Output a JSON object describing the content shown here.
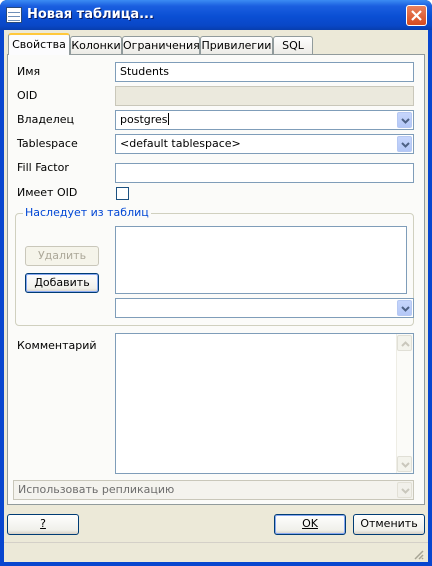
{
  "window": {
    "title": "Новая таблица..."
  },
  "tabs": [
    {
      "label": "Свойства"
    },
    {
      "label": "Колонки"
    },
    {
      "label": "Ограничения"
    },
    {
      "label": "Привилегии"
    },
    {
      "label": "SQL"
    }
  ],
  "form": {
    "name_label": "Имя",
    "name_value": "Students",
    "oid_label": "OID",
    "owner_label": "Владелец",
    "owner_value": "postgres",
    "tablespace_label": "Tablespace",
    "tablespace_value": "<default tablespace>",
    "fillfactor_label": "Fill Factor",
    "fillfactor_value": "",
    "hasoids_label": "Имеет OID",
    "inherits_group": "Наследует из таблиц",
    "remove_button": "Удалить",
    "add_button": "Добавить",
    "comment_label": "Комментарий",
    "replication_value": "Использовать репликацию"
  },
  "footer": {
    "help_button": "?",
    "ok_button": "OK",
    "cancel_button": "Отменить"
  },
  "icons": {
    "window": "table-icon",
    "close": "close-icon",
    "dropdown": "chevron-down-icon"
  }
}
